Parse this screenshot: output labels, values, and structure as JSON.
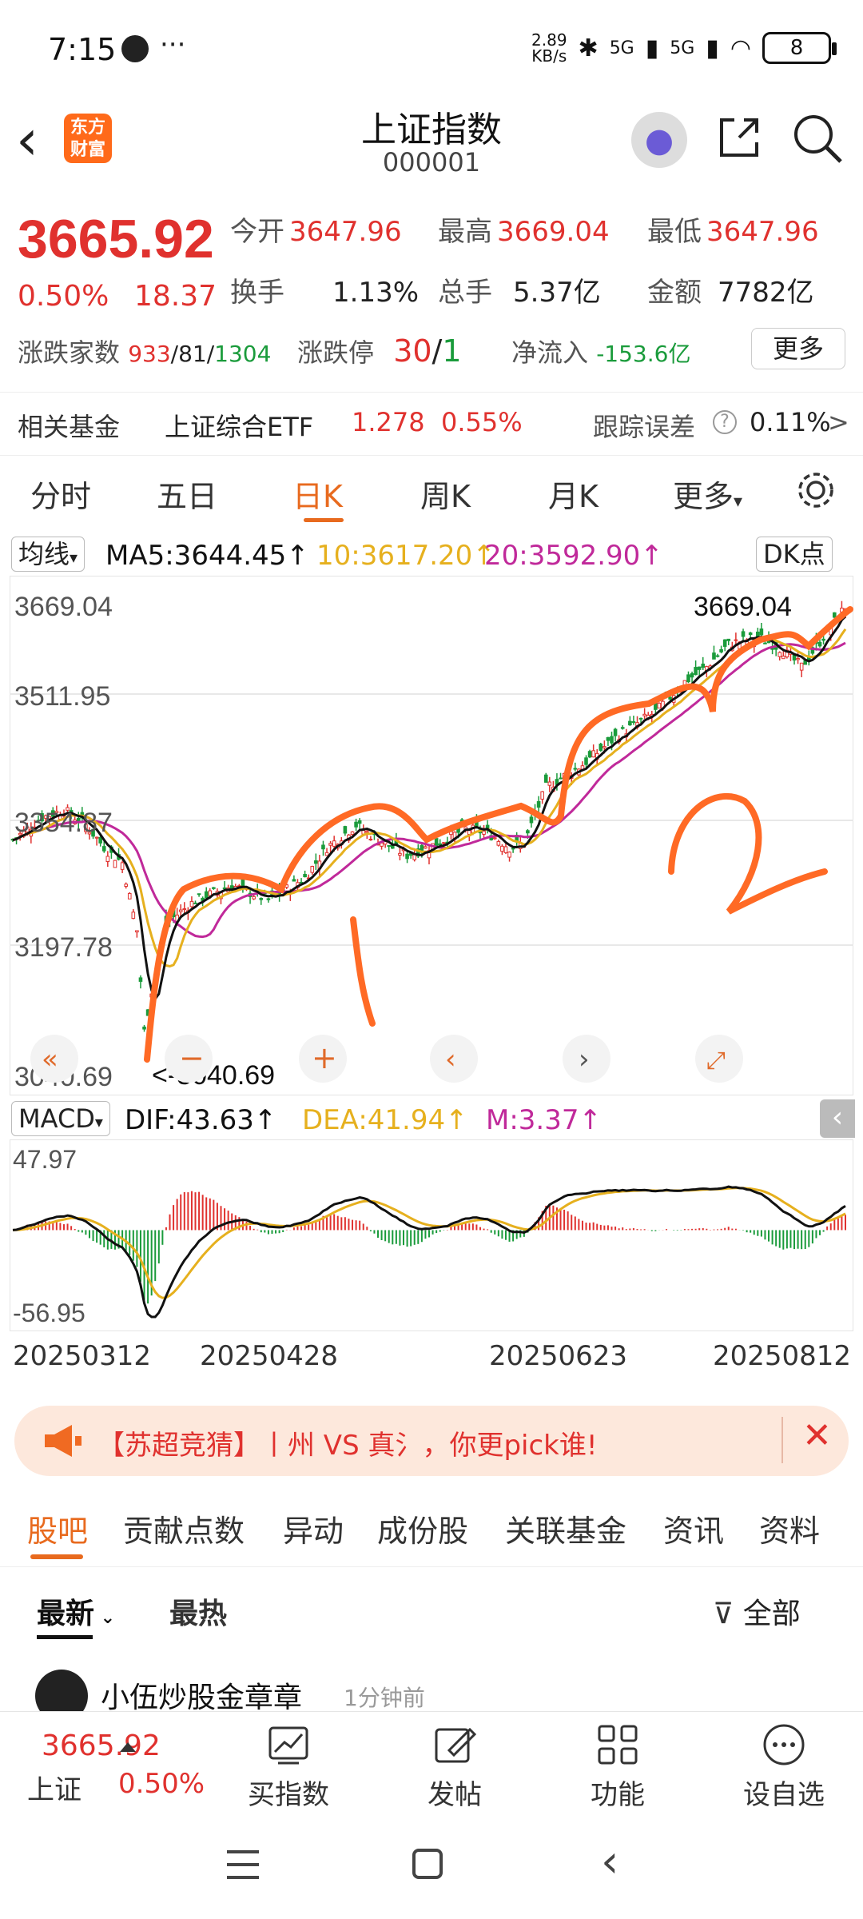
{
  "status_bar": {
    "time": "7:15",
    "net_speed_value": "2.89",
    "net_speed_unit": "KB/s",
    "signal1": "5G",
    "signal2": "5G",
    "wifi_sub": "6",
    "battery": "8"
  },
  "header": {
    "logo_line1": "东方",
    "logo_line2": "财富",
    "title": "上证指数",
    "code": "000001"
  },
  "quote": {
    "price": "3665.92",
    "change_pct": "0.50%",
    "change_abs": "18.37",
    "open_label": "今开",
    "open": "3647.96",
    "high_label": "最高",
    "high": "3669.04",
    "low_label": "最低",
    "low": "3647.96",
    "turnover_label": "换手",
    "turnover": "1.13%",
    "volume_label": "总手",
    "volume": "5.37亿",
    "amount_label": "金额",
    "amount": "7782亿",
    "adv_dec_label": "涨跌家数",
    "adv": "933",
    "sep1": "/",
    "flat": "81",
    "sep2": "/",
    "dec": "1304",
    "limit_label": "涨跌停",
    "limit_up": "30",
    "limit_sep": "/",
    "limit_down": "1",
    "netflow_label": "净流入",
    "netflow": "-153.6亿",
    "more": "更多"
  },
  "fund": {
    "label": "相关基金",
    "name": "上证综合ETF",
    "price": "1.278",
    "pct": "0.55%",
    "track_label": "跟踪误差",
    "track": "0.11%",
    "arrow": ">"
  },
  "chart_tabs": [
    "分时",
    "五日",
    "日K",
    "周K",
    "月K",
    "更多"
  ],
  "chart_tab_active": 2,
  "ma": {
    "selector": "均线",
    "ma5": "MA5:3644.45",
    "ma10": "10:3617.20",
    "ma20": "20:3592.90",
    "up": "↑",
    "dk": "DK点"
  },
  "price_axis": {
    "top": "3669.04",
    "l2": "3511.95",
    "l3": "3354.87",
    "l4": "3197.78",
    "bottom": "3040.69",
    "high_marker": "3669.04",
    "low_marker": "<-3040.69"
  },
  "macd": {
    "selector": "MACD",
    "dif": "DIF:43.63",
    "dea": "DEA:41.94",
    "m": "M:3.37",
    "up": "↑",
    "top": "47.97",
    "bottom": "-56.95"
  },
  "dates": [
    "20250312",
    "20250428",
    "20250623",
    "20250812"
  ],
  "banner": {
    "text": "【苏超竞猜】丨州 VS 真氵，你更pick谁!"
  },
  "content_tabs": [
    "股吧",
    "贡献点数",
    "异动",
    "成份股",
    "关联基金",
    "资讯",
    "资料"
  ],
  "sort": {
    "latest": "最新",
    "hot": "最热",
    "filter": "全部"
  },
  "post_peek": {
    "author": "小伍炒股金章章",
    "time": "1分钟前"
  },
  "bottom_bar": {
    "index_price": "3665.92",
    "index_name": "上证",
    "index_pct": "0.50%",
    "buy": "买指数",
    "post": "发帖",
    "func": "功能",
    "watch": "设自选"
  },
  "colors": {
    "up": "#e0312e",
    "down": "#1a9b3b",
    "accent": "#e86a1e",
    "ma5": "#111111",
    "ma10": "#e6b01e",
    "ma20": "#c0299a"
  }
}
